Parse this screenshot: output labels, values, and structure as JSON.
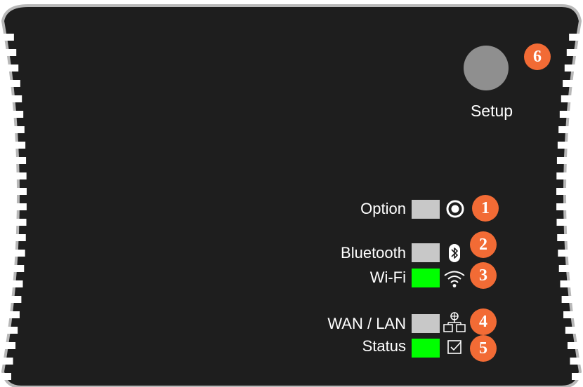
{
  "colors": {
    "panel": "#1e1e1e",
    "outline": "#b8b8b8",
    "led_off": "#c8c8c8",
    "led_on": "#00ff00",
    "badge": "#f26b35",
    "setup_button": "#8f8f8f",
    "text": "#ffffff"
  },
  "setup": {
    "label": "Setup",
    "badge": "6"
  },
  "indicators": [
    {
      "label": "Option",
      "led_state": "off",
      "icon": "target-icon",
      "badge": "1"
    },
    {
      "label": "Bluetooth",
      "led_state": "off",
      "icon": "bluetooth-icon",
      "badge": "2"
    },
    {
      "label": "Wi-Fi",
      "led_state": "on",
      "icon": "wifi-icon",
      "badge": "3"
    },
    {
      "label": "WAN / LAN",
      "led_state": "off",
      "icon": "network-icon",
      "badge": "4"
    },
    {
      "label": "Status",
      "led_state": "on",
      "icon": "checkbox-icon",
      "badge": "5"
    }
  ]
}
